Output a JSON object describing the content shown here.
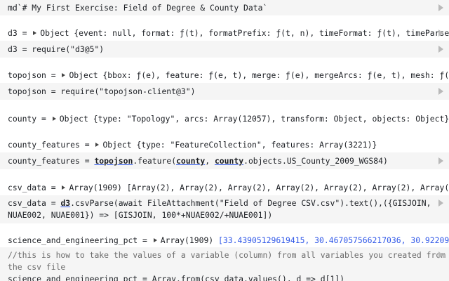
{
  "cells": {
    "md": "md`# My First Exercise: Field of Degree & County Data`",
    "d3_out": {
      "name": "d3 = ",
      "type": "Object",
      "body": "{event: null, format: ƒ(t), formatPrefix: ƒ(t, n), timeFormat: ƒ(t), timeParse: ƒ(t"
    },
    "d3_code": "d3 = require(\"d3@5\")",
    "topojson_out": {
      "name": "topojson = ",
      "type": "Object",
      "body": "{bbox: ƒ(e), feature: ƒ(e, t), merge: ƒ(e), mergeArcs: ƒ(e, t), mesh: ƒ(e), m"
    },
    "topojson_code": "topojson = require(\"topojson-client@3\")",
    "county_out": {
      "name": "county = ",
      "type": "Object",
      "body": "{type: \"Topology\", arcs: Array(12057), transform: Object, objects: Object}"
    },
    "county_features_out": {
      "name": "county_features = ",
      "type": "Object",
      "body": "{type: \"FeatureCollection\", features: Array(3221)}"
    },
    "county_features_code": {
      "prefix": "county_features = ",
      "ref1": "topojson",
      "mid1": ".feature(",
      "ref2": "county",
      "mid2": ", ",
      "ref3": "county",
      "suffix": ".objects.US_County_2009_WGS84)"
    },
    "csv_out": {
      "name": "csv_data = ",
      "type": "Array(1909)",
      "body": "[Array(2), Array(2), Array(2), Array(2), Array(2), Array(2), Array(2), A"
    },
    "csv_code": {
      "line1_prefix": "csv_data = ",
      "line1_ref": "d3",
      "line1_rest": ".csvParse(await FileAttachment(\"Field of Degree CSV.csv\").text(),({GISJOIN,",
      "line2": "NUAE002, NUAE001}) => [GISJOIN, 100*+NUAE002/+NUAE001])"
    },
    "sci_out": {
      "name": "science_and_engineering_pct = ",
      "type": "Array(1909)",
      "body": "[33.43905129619415, 30.467057566217036, 30.9220985691"
    },
    "sci_code": {
      "comment1": "//this is how to take the values of a variable (column) from all variables you created from",
      "comment2": "the csv file",
      "line3": "science_and_engineering_pct = Array.from(csv_data.values(), d => d[1])"
    }
  }
}
